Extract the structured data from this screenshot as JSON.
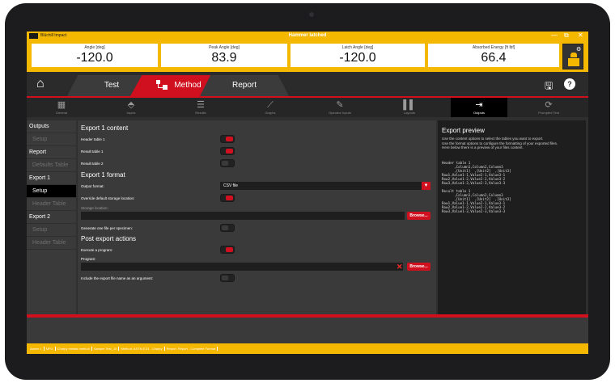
{
  "app": {
    "logo_text": "Blüchill Impact",
    "title": "Hammer latched",
    "window_controls": {
      "minimize": "—",
      "maximize": "⧉",
      "close": "✕"
    }
  },
  "readings": [
    {
      "label": "Angle  [deg]",
      "value": "-120.0"
    },
    {
      "label": "Peak Angle  [deg]",
      "value": "83.9"
    },
    {
      "label": "Latch Angle  [deg]",
      "value": "-120.0"
    },
    {
      "label": "Absorbed Energy  [ft lbf]",
      "value": "66.4"
    }
  ],
  "nav": {
    "tabs": [
      {
        "label": "Test",
        "active": false
      },
      {
        "label": "Method",
        "active": true
      },
      {
        "label": "Report",
        "active": false
      }
    ],
    "help_label": "?"
  },
  "subtabs": [
    {
      "label": "General",
      "icon": "grid-icon"
    },
    {
      "label": "Inputs",
      "icon": "tag-icon"
    },
    {
      "label": "Results",
      "icon": "list-icon"
    },
    {
      "label": "Graphs",
      "icon": "graph-icon"
    },
    {
      "label": "Operator Inputs",
      "icon": "edit-icon"
    },
    {
      "label": "Layouts",
      "icon": "layout-icon"
    },
    {
      "label": "Outputs",
      "icon": "export-icon",
      "active": true
    },
    {
      "label": "Prompted Test",
      "icon": "prompt-icon"
    }
  ],
  "sidebar": {
    "items": [
      {
        "label": "Outputs",
        "kind": "group"
      },
      {
        "label": "Setup",
        "kind": "sub"
      },
      {
        "label": "Report",
        "kind": "group"
      },
      {
        "label": "Defaults Table",
        "kind": "sub"
      },
      {
        "label": "Export 1",
        "kind": "group"
      },
      {
        "label": "Setup",
        "kind": "active"
      },
      {
        "label": "Header Table",
        "kind": "sub"
      },
      {
        "label": "Export 2",
        "kind": "group"
      },
      {
        "label": "Setup",
        "kind": "sub"
      },
      {
        "label": "Header Table",
        "kind": "sub"
      }
    ]
  },
  "content": {
    "export_content_title": "Export 1 content",
    "header_table_label": "Header table 1",
    "result_table1_label": "Result table 1",
    "result_table2_label": "Result table 2",
    "header_table_on": true,
    "result_table1_on": true,
    "result_table2_on": false,
    "export_format_title": "Export 1 format",
    "output_format_label": "Output format:",
    "output_format_value": "CSV file",
    "override_label": "Override default storage location:",
    "override_on": true,
    "storage_location_label": "Storage location:",
    "storage_location_value": "",
    "browse_label": "Browse...",
    "per_specimen_label": "Generate one file per specimen:",
    "per_specimen_on": false,
    "post_export_title": "Post export actions",
    "execute_label": "Execute a program:",
    "execute_on": true,
    "program_label": "Program:",
    "program_value": "",
    "clear_label": "✕",
    "program_browse_label": "Browse...",
    "include_arg_label": "Include the export file name as an argument:",
    "include_arg_on": false
  },
  "preview": {
    "title": "Export preview",
    "description": "Use the content options to select the tables you want to export.\nUse the format options to configure the formatting of your exported files.\nHere below there is a preview of your files content.",
    "body": "Header table 1\n      ,Column1,Column2,Column3\n      ,[Unit1]  ,[Unit2]  ,[Unit3]\nRow1,Value1-1,Value2-1,Value3-1\nRow2,Value1-2,Value2-2,Value3-2\nRow3,Value1-3,Value2-3,Value3-3\n\nResult table 1\n      ,Column1,Column2,Column3\n      ,[Unit1]  ,[Unit2]  ,[Unit3]\nRow1,Value1-1,Value2-1,Value3-1\nRow2,Value1-2,Value2-2,Value3-2\nRow3,Value1-3,Value2-3,Value3-3"
  },
  "statusbar": {
    "segments": [
      "Admin 1",
      "MFG",
      "Charpy metals method",
      "Sample Test_10",
      "Method: ASTM E23 - Charpy",
      "Report: Report - Complete Format"
    ]
  },
  "colors": {
    "accent_yellow": "#f5b800",
    "accent_red": "#d0101e",
    "panel_dark": "#3a3a3a",
    "preview_bg": "#1e1e1e"
  }
}
